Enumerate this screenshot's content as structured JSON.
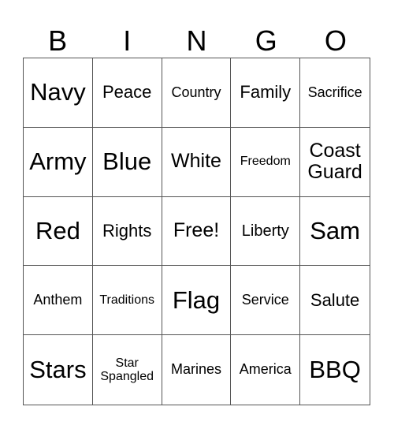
{
  "header": {
    "letters": [
      "B",
      "I",
      "N",
      "G",
      "O"
    ]
  },
  "cells": [
    "Navy",
    "Peace",
    "Country",
    "Family",
    "Sacrifice",
    "Army",
    "Blue",
    "White",
    "Freedom",
    "Coast Guard",
    "Red",
    "Rights",
    "Free!",
    "Liberty",
    "Sam",
    "Anthem",
    "Traditions",
    "Flag",
    "Service",
    "Salute",
    "Stars",
    "Star Spangled",
    "Marines",
    "America",
    "BBQ"
  ]
}
